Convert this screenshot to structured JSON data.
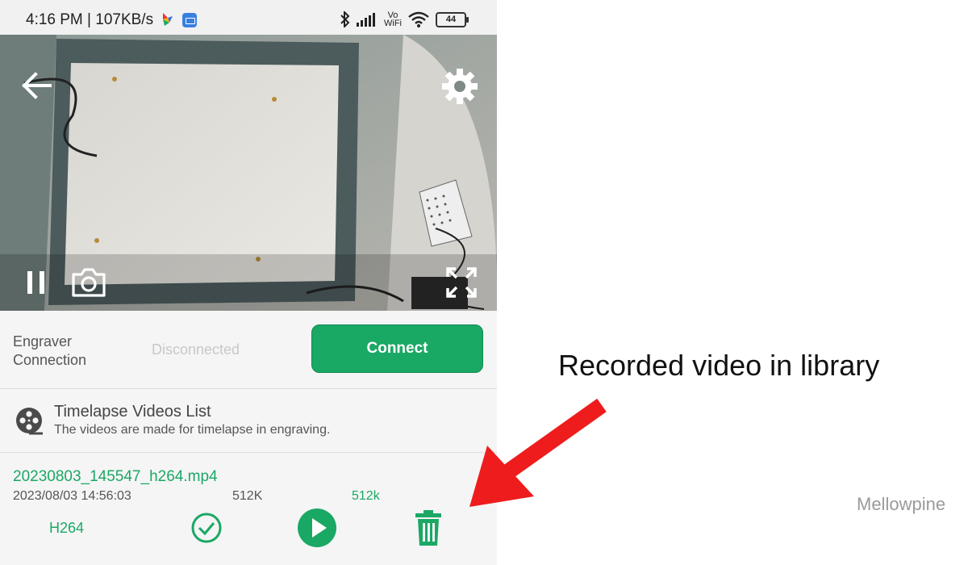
{
  "status_bar": {
    "time_speed": "4:16 PM | 107KB/s",
    "vo_wifi": "Vo\nWiFi",
    "battery": "44",
    "icons": [
      "bluetooth-icon",
      "signal-icon",
      "vowifi-icon",
      "wifi-icon",
      "battery-icon"
    ]
  },
  "camera": {
    "controls": [
      "back-icon",
      "settings-icon",
      "pause-icon",
      "camera-icon",
      "fullscreen-icon"
    ]
  },
  "connection": {
    "label": "Engraver\nConnection",
    "status": "Disconnected",
    "button": "Connect"
  },
  "timelapse": {
    "title": "Timelapse Videos List",
    "subtitle": "The videos are made for timelapse in engraving.",
    "items": [
      {
        "filename": "20230803_145547_h264.mp4",
        "datetime": "2023/08/03 14:56:03",
        "size": "512K",
        "size_alt": "512k",
        "codec": "H264"
      }
    ]
  },
  "annotation": {
    "caption": "Recorded video in library",
    "watermark": "Mellowpine"
  },
  "colors": {
    "accent": "#1aa865",
    "arrow": "#ee1c1c"
  }
}
